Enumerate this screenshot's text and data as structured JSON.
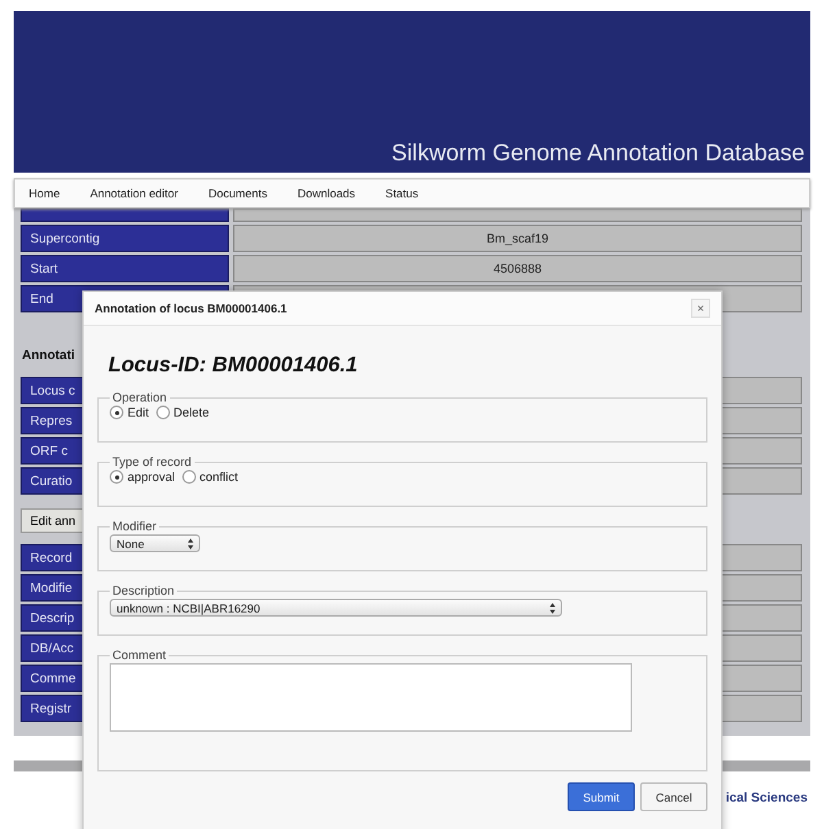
{
  "header": {
    "title": "Silkworm Genome Annotation Database"
  },
  "nav": [
    "Home",
    "Annotation editor",
    "Documents",
    "Downloads",
    "Status"
  ],
  "locus_table": [
    {
      "label": "Supercontig",
      "value": "Bm_scaf19"
    },
    {
      "label": "Start",
      "value": "4506888"
    },
    {
      "label": "End"
    }
  ],
  "annotation_heading": "Annotati",
  "annotation_rows": [
    "Locus c",
    "Repres",
    "ORF c",
    "Curatio"
  ],
  "edit_button": "Edit ann",
  "record_rows": [
    "Record",
    "Modifie",
    "Descrip",
    "DB/Acc",
    "Comme",
    "Registr"
  ],
  "footer": "ical Sciences",
  "dialog": {
    "title": "Annotation of locus BM00001406.1",
    "close": "×",
    "heading": "Locus-ID: BM00001406.1",
    "sections": [
      {
        "kind": "radio",
        "legend": "Operation",
        "options": [
          {
            "label": "Edit",
            "selected": true
          },
          {
            "label": "Delete",
            "selected": false
          }
        ]
      },
      {
        "kind": "radio",
        "legend": "Type of record",
        "options": [
          {
            "label": "approval",
            "selected": true
          },
          {
            "label": "conflict",
            "selected": false
          }
        ]
      },
      {
        "kind": "select",
        "legend": "Modifier",
        "value": "None",
        "wide": false
      },
      {
        "kind": "select",
        "legend": "Description",
        "value": "unknown : NCBI|ABR16290",
        "wide": true
      },
      {
        "kind": "textarea",
        "legend": "Comment"
      }
    ],
    "buttons": [
      {
        "label": "Submit",
        "primary": true
      },
      {
        "label": "Cancel",
        "primary": false
      }
    ]
  }
}
